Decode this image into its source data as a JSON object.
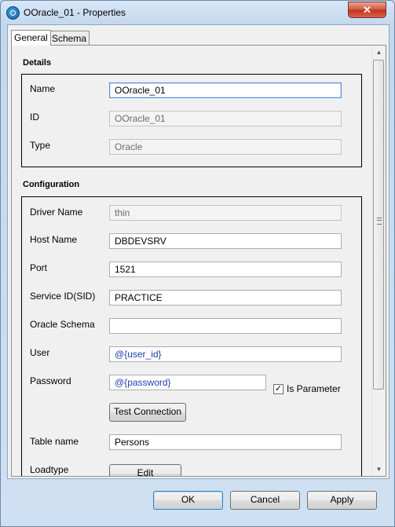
{
  "window": {
    "title": "OOracle_01 - Properties",
    "close_glyph": "✕",
    "app_icon": "app-icon"
  },
  "tabs": [
    {
      "label": "General",
      "active": true
    },
    {
      "label": "Schema",
      "active": false
    }
  ],
  "details": {
    "title": "Details",
    "name_label": "Name",
    "name_value": "OOracle_01",
    "id_label": "ID",
    "id_value": "OOracle_01",
    "type_label": "Type",
    "type_value": "Oracle"
  },
  "configuration": {
    "title": "Configuration",
    "driver_label": "Driver Name",
    "driver_value": "thin",
    "host_label": "Host Name",
    "host_value": "DBDEVSRV",
    "port_label": "Port",
    "port_value": "1521",
    "sid_label": "Service ID(SID)",
    "sid_value": "PRACTICE",
    "schema_label": "Oracle Schema",
    "schema_value": "",
    "user_label": "User",
    "user_value": "@{user_id}",
    "password_label": "Password",
    "password_value": "@{password}",
    "is_parameter_label": "Is Parameter",
    "is_parameter_checked": true,
    "check_glyph": "✓",
    "test_connection_label": "Test Connection",
    "table_label": "Table name",
    "table_value": "Persons",
    "loadtype_label": "Loadtype",
    "edit_label": "Edit"
  },
  "scrollbar": {
    "up_glyph": "▲",
    "down_glyph": "▼"
  },
  "footer": {
    "ok_label": "OK",
    "cancel_label": "Cancel",
    "apply_label": "Apply"
  },
  "colors": {
    "param_text": "#1a3fb0",
    "focus_border": "#5593d1",
    "close_button": "#c1321a"
  }
}
